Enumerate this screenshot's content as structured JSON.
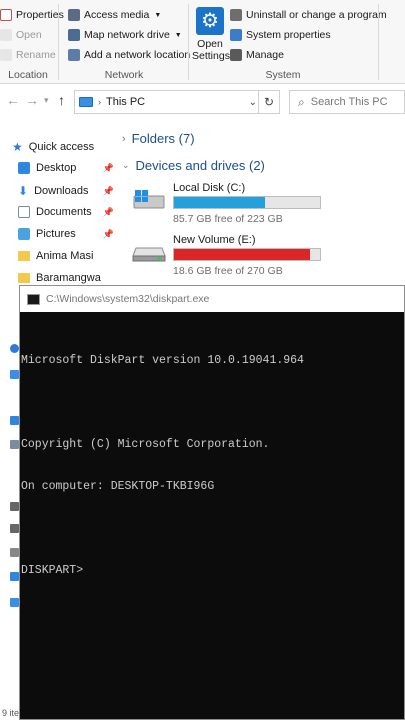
{
  "ribbon": {
    "properties": "Properties",
    "open_small": "Open",
    "rename": "Rename",
    "location_label": "Location",
    "access_media": "Access media",
    "map_drive": "Map network drive",
    "add_location": "Add a network location",
    "network_label": "Network",
    "open_settings_line1": "Open",
    "open_settings_line2": "Settings",
    "uninstall": "Uninstall or change a program",
    "system_properties": "System properties",
    "manage": "Manage",
    "system_label": "System"
  },
  "address": {
    "path": "This PC",
    "search_placeholder": "Search This PC"
  },
  "sidebar": {
    "items": [
      {
        "label": "Quick access"
      },
      {
        "label": "Desktop"
      },
      {
        "label": "Downloads"
      },
      {
        "label": "Documents"
      },
      {
        "label": "Pictures"
      },
      {
        "label": "Anima Masi"
      },
      {
        "label": "Baramangwa"
      }
    ]
  },
  "main": {
    "folders_header": "Folders (7)",
    "drives_header": "Devices and drives (2)",
    "drives": [
      {
        "name": "Local Disk (C:)",
        "free": "85.7 GB free of 223 GB",
        "used_fraction": 0.62,
        "bar_color": "#26a0da"
      },
      {
        "name": "New Volume (E:)",
        "free": "18.6 GB free of 270 GB",
        "used_fraction": 0.93,
        "bar_color": "#da2626"
      }
    ]
  },
  "console": {
    "title": "C:\\Windows\\system32\\diskpart.exe",
    "lines": [
      "Microsoft DiskPart version 10.0.19041.964",
      "",
      "Copyright (C) Microsoft Corporation.",
      "On computer: DESKTOP-TKBI96G",
      "",
      "DISKPART>"
    ]
  },
  "status": {
    "items_count": "9 ite"
  }
}
